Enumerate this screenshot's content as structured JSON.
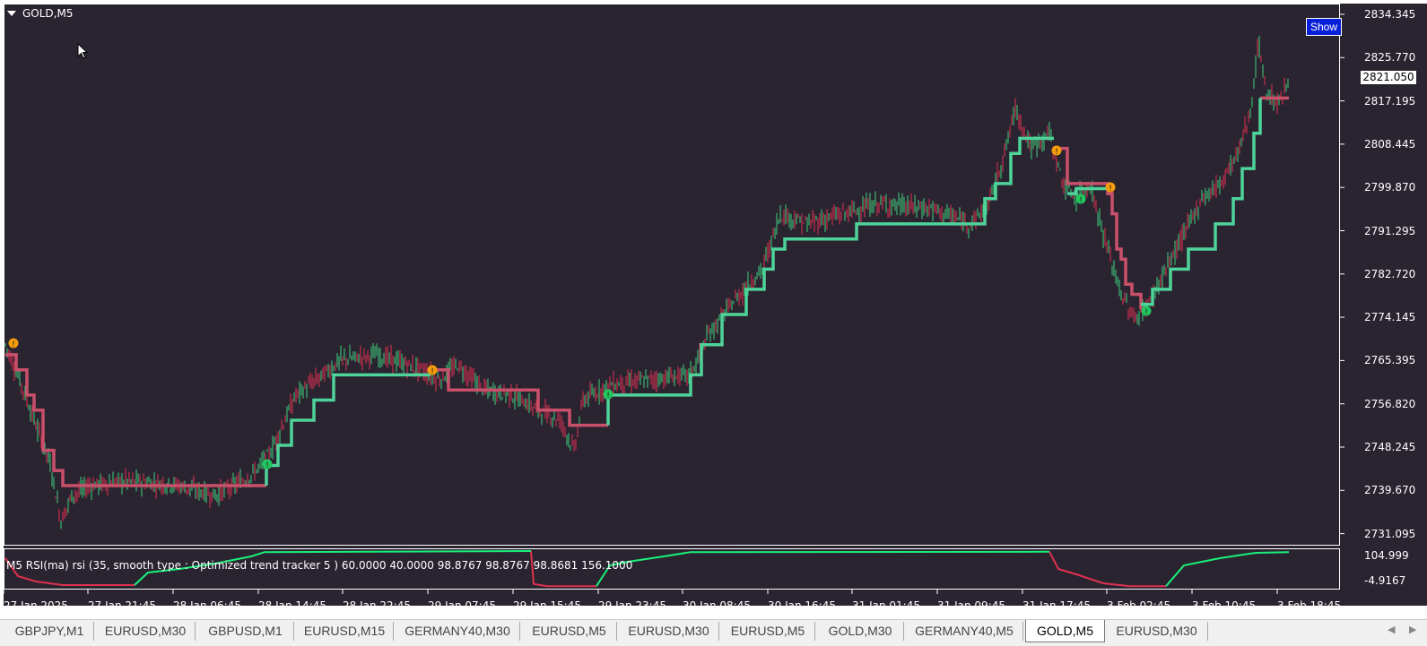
{
  "chart": {
    "title": "GOLD,M5",
    "show_button": "Show",
    "current_price": "2821.050",
    "price_axis": [
      "2834.345",
      "2825.770",
      "2817.195",
      "2808.445",
      "2799.870",
      "2791.295",
      "2782.720",
      "2774.145",
      "2765.395",
      "2756.820",
      "2748.245",
      "2739.670",
      "2731.095"
    ],
    "time_axis": [
      "27 Jan 2025",
      "27 Jan 21:45",
      "28 Jan 06:45",
      "28 Jan 14:45",
      "28 Jan 22:45",
      "29 Jan 07:45",
      "29 Jan 15:45",
      "29 Jan 23:45",
      "30 Jan 08:45",
      "30 Jan 16:45",
      "31 Jan 01:45",
      "31 Jan 09:45",
      "31 Jan 17:45",
      "3 Feb 02:45",
      "3 Feb 10:45",
      "3 Feb 18:45"
    ],
    "colors": {
      "background": "#2a2431",
      "bull": "#3fd07a",
      "bear": "#e0304f",
      "up_line": "#4ed39a",
      "down_line": "#c9506a",
      "signal_buy": "#22c55e",
      "signal_sell": "#f59e0b"
    }
  },
  "indicator": {
    "title": "M5 RSI(ma) rsi (35, smooth type : Optimized trend tracker  5 ) 60.0000 40.0000 98.8767 98.8767 98.8681 156.1000",
    "scale_top": "104.999",
    "scale_bottom": "-4.9167",
    "colors": {
      "up": "#19f07a",
      "down": "#e0304f"
    }
  },
  "tabs": [
    {
      "label": "GBPJPY,M1",
      "active": false
    },
    {
      "label": "EURUSD,M30",
      "active": false
    },
    {
      "label": "GBPUSD,M1",
      "active": false
    },
    {
      "label": "EURUSD,M15",
      "active": false
    },
    {
      "label": "GERMANY40,M30",
      "active": false
    },
    {
      "label": "EURUSD,M5",
      "active": false
    },
    {
      "label": "EURUSD,M30",
      "active": false
    },
    {
      "label": "EURUSD,M5",
      "active": false
    },
    {
      "label": "GOLD,M30",
      "active": false
    },
    {
      "label": "GERMANY40,M5",
      "active": false
    },
    {
      "label": "GOLD,M5",
      "active": true
    },
    {
      "label": "EURUSD,M30",
      "active": false
    }
  ],
  "chart_data": {
    "type": "line",
    "title": "GOLD,M5",
    "x": [
      "27 Jan 2025",
      "27 Jan 21:45",
      "28 Jan 06:45",
      "28 Jan 14:45",
      "28 Jan 22:45",
      "29 Jan 07:45",
      "29 Jan 15:45",
      "29 Jan 23:45",
      "30 Jan 08:45",
      "30 Jan 16:45",
      "31 Jan 01:45",
      "31 Jan 09:45",
      "31 Jan 17:45",
      "3 Feb 02:45",
      "3 Feb 10:45",
      "3 Feb 18:45"
    ],
    "series": [
      {
        "values": [
          2767.5,
          2740.3,
          2740.3,
          2745.5,
          2763.0,
          2763.0,
          2758.5,
          2759.5,
          2772.5,
          2789.5,
          2792.5,
          2792.5,
          2805.0,
          2778.0,
          2798.0,
          2820.0
        ]
      }
    ],
    "ylim": [
      2731.095,
      2834.345
    ]
  }
}
